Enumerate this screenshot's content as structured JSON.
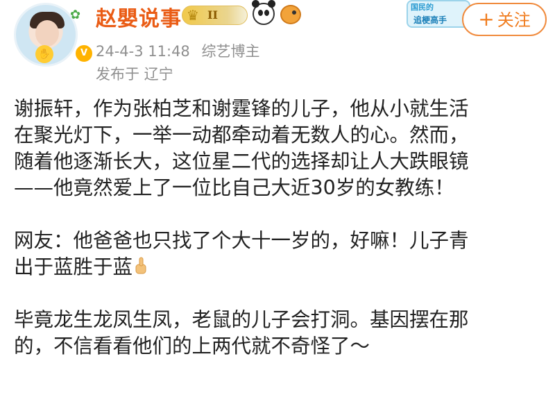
{
  "header": {
    "username": "赵嬰说事",
    "level_badge": "II",
    "timestamp": "24-4-3 11:48",
    "category": "综艺博主",
    "location": "发布于 辽宁",
    "follow_label": "关注",
    "sticker": {
      "line1": "国民的",
      "line2": "追梗高手"
    }
  },
  "post": {
    "paragraphs": [
      [
        "谢振轩，作为张柏芝和谢霆锋的儿子，他从小就生活",
        "在聚光灯下，一举一动都牵动着无数人的心。然而，",
        "随着他逐渐长大，这位星二代的选择却让人大跌眼镜",
        "——他竟然爱上了一位比自己大近30岁的女教练！"
      ],
      [
        "网友：他爸爸也只找了个大十一岁的，好嘛！儿子青",
        "出于蓝胜于蓝"
      ],
      [
        "毕竟龙生龙凤生凤，老鼠的儿子会打洞。基因摆在那",
        "的，不信看看他们的上两代就不奇怪了～"
      ]
    ]
  },
  "colors": {
    "username": "#ea5c15",
    "follow": "#f07c1e",
    "meta": "#8f8f8f"
  },
  "icons": [
    "crown-icon",
    "panda-icon",
    "fish-icon",
    "thumbs-up-icon",
    "plus-icon"
  ]
}
